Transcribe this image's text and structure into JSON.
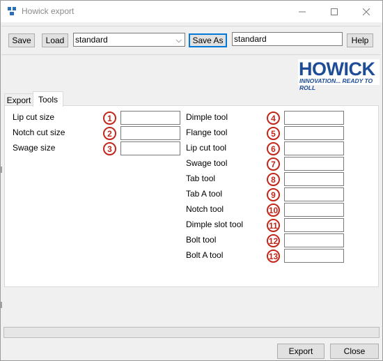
{
  "window": {
    "title": "Howick export"
  },
  "toolbar": {
    "save_label": "Save",
    "load_label": "Load",
    "profile_select_value": "standard",
    "save_as_label": "Save As",
    "save_as_name_value": "standard",
    "help_label": "Help"
  },
  "logo": {
    "word": "HOWICK",
    "tagline": "INNOVATION... READY TO ROLL"
  },
  "tabs": {
    "export": "Export",
    "tools": "Tools"
  },
  "left_fields": [
    {
      "label": "Lip cut size",
      "number": "1"
    },
    {
      "label": "Notch cut size",
      "number": "2"
    },
    {
      "label": "Swage size",
      "number": "3"
    }
  ],
  "right_fields": [
    {
      "label": "Dimple tool",
      "number": "4"
    },
    {
      "label": "Flange tool",
      "number": "5"
    },
    {
      "label": "Lip cut tool",
      "number": "6"
    },
    {
      "label": "Swage tool",
      "number": "7"
    },
    {
      "label": "Tab tool",
      "number": "8"
    },
    {
      "label": "Tab A tool",
      "number": "9"
    },
    {
      "label": "Notch tool",
      "number": "10"
    },
    {
      "label": "Dimple slot tool",
      "number": "11"
    },
    {
      "label": "Bolt tool",
      "number": "12"
    },
    {
      "label": "Bolt A tool",
      "number": "13"
    }
  ],
  "footer": {
    "export_label": "Export",
    "close_label": "Close"
  },
  "colors": {
    "accent": "#0078d7",
    "callout": "#c0271a",
    "logo_blue": "#1e4d97"
  }
}
